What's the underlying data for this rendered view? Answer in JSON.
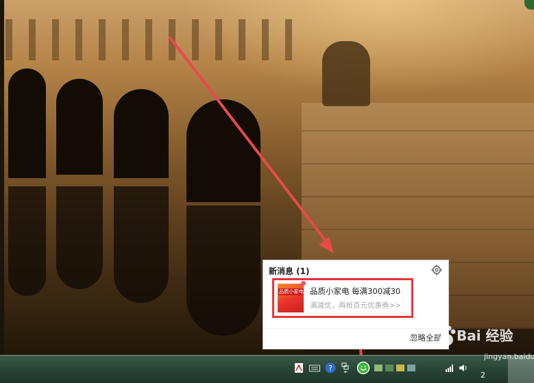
{
  "notification": {
    "header": "新消息 (1)",
    "message_title": "品质小家电 每满300减30",
    "message_subtitle": "满减优，再抢百元优惠券>>",
    "thumbnail_label": "品质小家电",
    "ignore_all": "忽略全部"
  },
  "taskbar": {
    "clock_text": "2"
  },
  "watermark": {
    "brand": "Bai 经验",
    "url": "jingyan.baidu.com"
  },
  "colors": {
    "highlight_red": "#e8343a",
    "taskbar": "#284436"
  },
  "icons": [
    "settings-gear-icon",
    "pdf-icon",
    "keyboard-icon",
    "help-icon",
    "network-icon",
    "app-tray-icon",
    "signal-icon",
    "volume-icon"
  ]
}
